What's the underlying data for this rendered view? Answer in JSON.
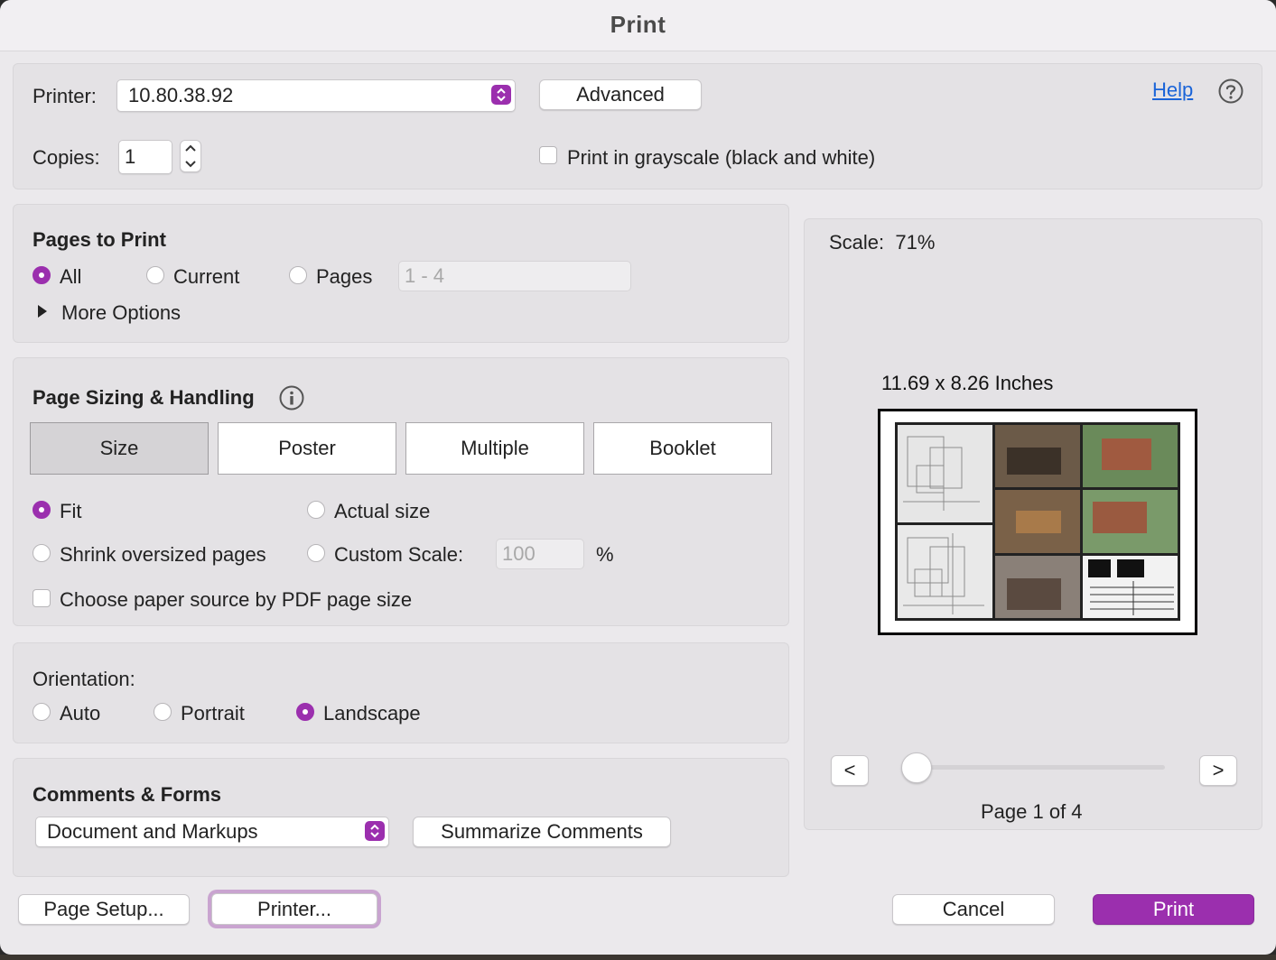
{
  "window": {
    "title": "Print"
  },
  "printer": {
    "label": "Printer:",
    "value": "10.80.38.92",
    "advanced_label": "Advanced",
    "help_label": "Help"
  },
  "copies": {
    "label": "Copies:",
    "value": "1",
    "grayscale_label": "Print in grayscale (black and white)",
    "grayscale_checked": false
  },
  "pages_to_print": {
    "heading": "Pages to Print",
    "options": [
      "All",
      "Current",
      "Pages"
    ],
    "selected": "All",
    "range_placeholder": "1 - 4",
    "more_options_label": "More Options"
  },
  "sizing": {
    "heading": "Page Sizing & Handling",
    "tabs": [
      "Size",
      "Poster",
      "Multiple",
      "Booklet"
    ],
    "active_tab": "Size",
    "fit_label": "Fit",
    "actual_size_label": "Actual size",
    "shrink_label": "Shrink oversized pages",
    "custom_scale_label": "Custom Scale:",
    "custom_scale_value": "100",
    "percent_label": "%",
    "paper_source_label": "Choose paper source by PDF page size",
    "selected": "Fit"
  },
  "orientation": {
    "heading": "Orientation:",
    "options": [
      "Auto",
      "Portrait",
      "Landscape"
    ],
    "selected": "Landscape"
  },
  "comments_forms": {
    "heading": "Comments & Forms",
    "value": "Document and Markups",
    "summarize_label": "Summarize Comments"
  },
  "preview": {
    "scale_label": "Scale:",
    "scale_value": "71%",
    "paper_size": "11.69 x 8.26 Inches",
    "prev_label": "<",
    "next_label": ">",
    "page_indicator": "Page 1 of 4",
    "page_position": 0.0
  },
  "footer": {
    "page_setup_label": "Page Setup...",
    "printer_label": "Printer...",
    "cancel_label": "Cancel",
    "print_label": "Print"
  },
  "colors": {
    "accent": "#9b2fae",
    "link": "#1a64d8",
    "panel": "#e4e2e5"
  }
}
